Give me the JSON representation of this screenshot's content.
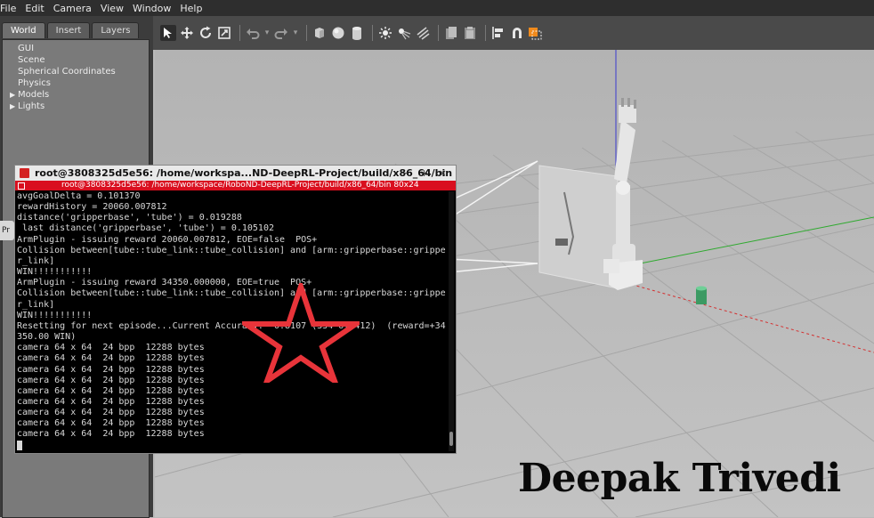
{
  "menu": [
    "File",
    "Edit",
    "Camera",
    "View",
    "Window",
    "Help"
  ],
  "left_panel": {
    "tabs": [
      "World",
      "Insert",
      "Layers"
    ],
    "active_tab": "World",
    "tree_items": [
      {
        "label": "GUI",
        "expandable": false
      },
      {
        "label": "Scene",
        "expandable": false
      },
      {
        "label": "Spherical Coordinates",
        "expandable": false
      },
      {
        "label": "Physics",
        "expandable": false
      },
      {
        "label": "Models",
        "expandable": true
      },
      {
        "label": "Lights",
        "expandable": true
      }
    ],
    "side_tab": "Pr"
  },
  "toolbar": {
    "icons": [
      "select-arrow-icon",
      "translate-icon",
      "rotate-icon",
      "scale-icon",
      "undo-icon",
      "redo-icon",
      "box-shape-icon",
      "sphere-shape-icon",
      "cylinder-shape-icon",
      "point-light-icon",
      "spot-light-icon",
      "directional-light-icon",
      "copy-icon",
      "paste-icon",
      "align-icon",
      "snap-icon",
      "change-color-icon"
    ]
  },
  "terminal": {
    "window_title": "root@3808325d5e56: /home/workspa...ND-DeepRL-Project/build/x86_64/bin",
    "window_controls": "− + ×",
    "tab_title": "root@3808325d5e56: /home/workspace/RoboND-DeepRL-Project/build/x86_64/bin 80x24",
    "lines": [
      "avgGoalDelta = 0.101370",
      "rewardHistory = 20060.007812",
      "distance('gripperbase', 'tube') = 0.019288",
      " last distance('gripperbase', 'tube') = 0.105102",
      "ArmPlugin - issuing reward 20060.007812, EOE=false  POS+",
      "Collision between[tube::tube_link::tube_collision] and [arm::gripperbase::grippe",
      "r_link]",
      "WIN!!!!!!!!!!!",
      "ArmPlugin - issuing reward 34350.000000, EOE=true  POS+",
      "Collision between[tube::tube_link::tube_collision] and [arm::gripperbase::grippe",
      "r_link]",
      "WIN!!!!!!!!!!!",
      "Resetting for next episode...Current Accuracy:  0.8107 (334 of 412)  (reward=+34",
      "350.00 WIN)",
      "camera 64 x 64  24 bpp  12288 bytes",
      "camera 64 x 64  24 bpp  12288 bytes",
      "camera 64 x 64  24 bpp  12288 bytes",
      "camera 64 x 64  24 bpp  12288 bytes",
      "camera 64 x 64  24 bpp  12288 bytes",
      "camera 64 x 64  24 bpp  12288 bytes",
      "camera 64 x 64  24 bpp  12288 bytes",
      "camera 64 x 64  24 bpp  12288 bytes",
      "camera 64 x 64  24 bpp  12288 bytes"
    ]
  },
  "watermark": "Deepak Trivedi",
  "colors": {
    "terminal_tab_bar": "#d90f1f",
    "star_outline": "#e8343a",
    "tube": "#3c9a63"
  }
}
